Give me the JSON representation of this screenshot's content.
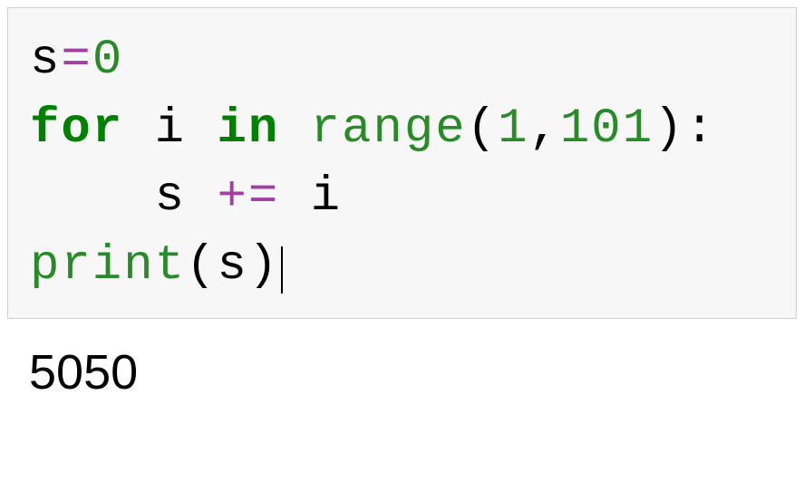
{
  "code": {
    "line1": {
      "var": "s",
      "op": "=",
      "num": "0"
    },
    "line2": {
      "kw_for": "for",
      "var_i": "i",
      "kw_in": "in",
      "fn_range": "range",
      "paren_open": "(",
      "arg1": "1",
      "comma": ",",
      "arg2": "101",
      "paren_close": ")",
      "colon": ":"
    },
    "line3": {
      "indent": "    ",
      "var_s": "s",
      "op_pluseq": "+=",
      "var_i": "i"
    },
    "line4": {
      "fn_print": "print",
      "paren_open": "(",
      "var_s": "s",
      "paren_close": ")"
    }
  },
  "output": {
    "text": "5050"
  }
}
